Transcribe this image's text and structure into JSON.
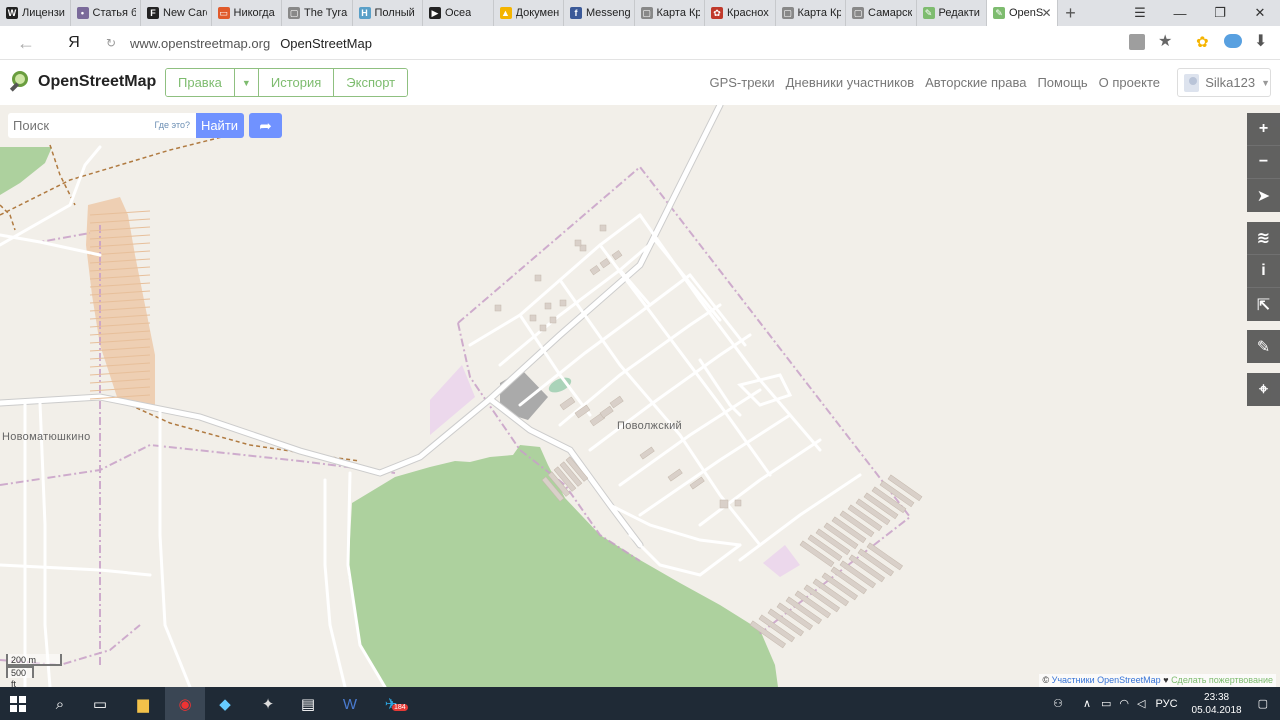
{
  "browser": {
    "tabs": [
      {
        "title": "Лицензи",
        "fav_color": "#222222",
        "fav_glyph": "W"
      },
      {
        "title": "Статья б",
        "fav_color": "#7a6a9a",
        "fav_glyph": "•"
      },
      {
        "title": "New Card",
        "fav_color": "#222222",
        "fav_glyph": "F"
      },
      {
        "title": "Никогда",
        "fav_color": "#e05a2b",
        "fav_glyph": "▭"
      },
      {
        "title": "The Tyran",
        "fav_color": "#888888",
        "fav_glyph": "▢"
      },
      {
        "title": "Полный",
        "fav_color": "#5aa0c8",
        "fav_glyph": "H"
      },
      {
        "title": "Ocea",
        "fav_color": "#222222",
        "fav_glyph": "▶"
      },
      {
        "title": "Докумен",
        "fav_color": "#f4b400",
        "fav_glyph": "▲"
      },
      {
        "title": "Messeng",
        "fav_color": "#3b5998",
        "fav_glyph": "f"
      },
      {
        "title": "Карта Кр",
        "fav_color": "#888888",
        "fav_glyph": "▢"
      },
      {
        "title": "Краснох",
        "fav_color": "#c0392b",
        "fav_glyph": "✿"
      },
      {
        "title": "Карта Кр",
        "fav_color": "#888888",
        "fav_glyph": "▢"
      },
      {
        "title": "Самарск",
        "fav_color": "#888888",
        "fav_glyph": "▢"
      },
      {
        "title": "Редакти",
        "fav_color": "#7ebc6f",
        "fav_glyph": "✎"
      },
      {
        "title": "OpenS",
        "fav_color": "#7ebc6f",
        "fav_glyph": "✎",
        "active": true
      }
    ],
    "url": "www.openstreetmap.org",
    "page_title": "OpenStreetMap",
    "ya_glyph": "Я"
  },
  "osm": {
    "logo_text": "OpenStreetMap",
    "edit_label": "Правка",
    "history_label": "История",
    "export_label": "Экспорт",
    "nav": [
      "GPS-треки",
      "Дневники участников",
      "Авторские права",
      "Помощь",
      "О проекте"
    ],
    "username": "Silka123"
  },
  "search": {
    "placeholder": "Поиск",
    "where_is": "Где это?",
    "find_label": "Найти"
  },
  "map": {
    "labels": {
      "town1": "Новоматюшкино",
      "town2": "Поволжский"
    },
    "scale_metric": "200 m",
    "scale_imperial": "500 ft",
    "attribution_prefix": "©",
    "attribution_link": "Участники OpenStreetMap",
    "attribution_sep": "♥",
    "attribution_donate": "Сделать пожертвование",
    "colors": {
      "background": "#f2efe9",
      "forest": "#add19e",
      "allotments": "#eecfb3",
      "buildings": "#d9d0c9",
      "roads": "#ffffff",
      "boundary": "#c8a0c8"
    }
  },
  "taskbar": {
    "time": "23:38",
    "date": "05.04.2018",
    "lang": "РУС",
    "telegram_badge": "184"
  }
}
